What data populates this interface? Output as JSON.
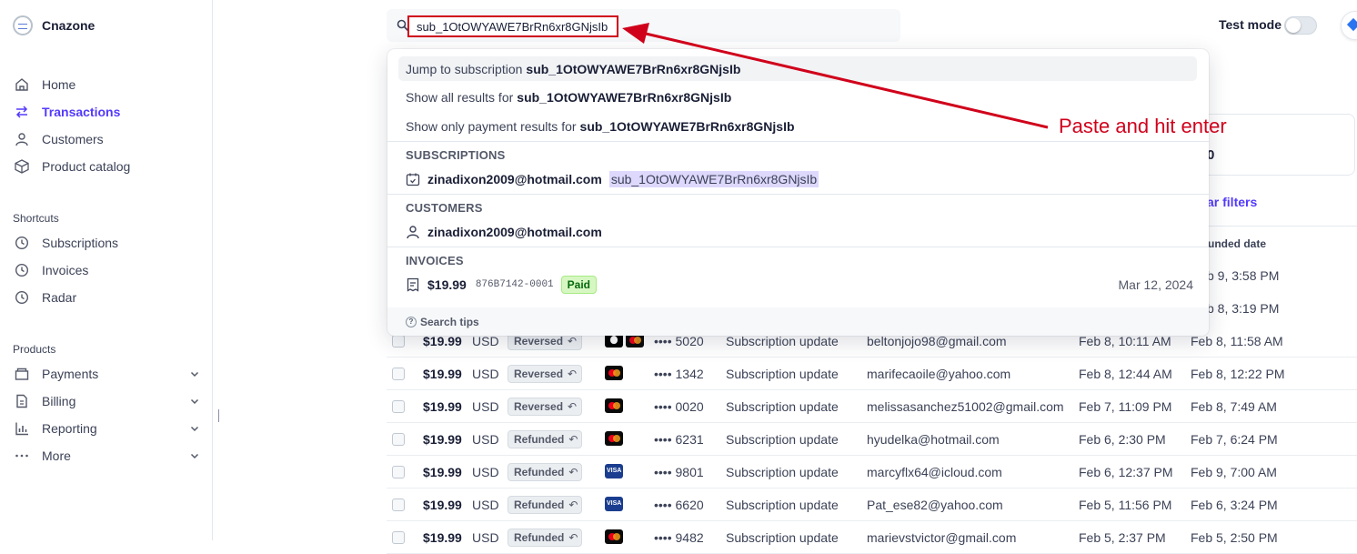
{
  "sidebar": {
    "brand": "Cnazone",
    "nav": [
      {
        "label": "Home",
        "icon": "home-icon"
      },
      {
        "label": "Transactions",
        "icon": "transactions-icon",
        "active": true
      },
      {
        "label": "Customers",
        "icon": "customers-icon"
      },
      {
        "label": "Product catalog",
        "icon": "product-catalog-icon"
      }
    ],
    "shortcuts_label": "Shortcuts",
    "shortcuts": [
      {
        "label": "Subscriptions",
        "icon": "clock-icon"
      },
      {
        "label": "Invoices",
        "icon": "clock-icon"
      },
      {
        "label": "Radar",
        "icon": "clock-icon"
      }
    ],
    "products_label": "Products",
    "products": [
      {
        "label": "Payments",
        "icon": "payments-icon"
      },
      {
        "label": "Billing",
        "icon": "billing-icon"
      },
      {
        "label": "Reporting",
        "icon": "reporting-icon"
      },
      {
        "label": "More",
        "icon": "more-icon"
      }
    ]
  },
  "topbar": {
    "search_value": "sub_1OtOWYAWE7BrRn6xr8GNjsIb",
    "test_mode_label": "Test mode"
  },
  "dropdown": {
    "jump_prefix": "Jump to subscription",
    "show_all_prefix": "Show all results for",
    "show_payments_prefix": "Show only payment results for",
    "query": "sub_1OtOWYAWE7BrRn6xr8GNjsIb",
    "subscriptions_heading": "SUBSCRIPTIONS",
    "subscription_email": "zinadixon2009@hotmail.com",
    "subscription_id": "sub_1OtOWYAWE7BrRn6xr8GNjsIb",
    "customers_heading": "CUSTOMERS",
    "customer_email": "zinadixon2009@hotmail.com",
    "invoices_heading": "INVOICES",
    "invoice_amount": "$19.99",
    "invoice_number": "876B7142-0001",
    "invoice_status": "Paid",
    "invoice_date": "Mar 12, 2024",
    "search_tips": "Search tips"
  },
  "annotation": "Paste and hit enter",
  "background": {
    "card_value": "0",
    "clear_filters": "ar filters",
    "refunded_header": "unded date",
    "partial_dates": [
      "b 9, 3:58 PM",
      "b 8, 3:19 PM"
    ]
  },
  "rows": [
    {
      "amount": "$19.99",
      "currency": "USD",
      "status": "Reversed",
      "cards": [
        "apple",
        "mc"
      ],
      "last4": "•••• 5020",
      "description": "Subscription update",
      "email": "beltonjojo98@gmail.com",
      "date": "Feb 8, 10:11 AM",
      "refunded": "Feb 8, 11:58 AM"
    },
    {
      "amount": "$19.99",
      "currency": "USD",
      "status": "Reversed",
      "cards": [
        "mc"
      ],
      "last4": "•••• 1342",
      "description": "Subscription update",
      "email": "marifecaoile@yahoo.com",
      "date": "Feb 8, 12:44 AM",
      "refunded": "Feb 8, 12:22 PM"
    },
    {
      "amount": "$19.99",
      "currency": "USD",
      "status": "Reversed",
      "cards": [
        "mc"
      ],
      "last4": "•••• 0020",
      "description": "Subscription update",
      "email": "melissasanchez51002@gmail.com",
      "date": "Feb 7, 11:09 PM",
      "refunded": "Feb 8, 7:49 AM"
    },
    {
      "amount": "$19.99",
      "currency": "USD",
      "status": "Refunded",
      "cards": [
        "mc"
      ],
      "last4": "•••• 6231",
      "description": "Subscription update",
      "email": "hyudelka@hotmail.com",
      "date": "Feb 6, 2:30 PM",
      "refunded": "Feb 7, 6:24 PM"
    },
    {
      "amount": "$19.99",
      "currency": "USD",
      "status": "Refunded",
      "cards": [
        "visa"
      ],
      "last4": "•••• 9801",
      "description": "Subscription update",
      "email": "marcyflx64@icloud.com",
      "date": "Feb 6, 12:37 PM",
      "refunded": "Feb 9, 7:00 AM"
    },
    {
      "amount": "$19.99",
      "currency": "USD",
      "status": "Refunded",
      "cards": [
        "visa"
      ],
      "last4": "•••• 6620",
      "description": "Subscription update",
      "email": "Pat_ese82@yahoo.com",
      "date": "Feb 5, 11:56 PM",
      "refunded": "Feb 6, 3:24 PM"
    },
    {
      "amount": "$19.99",
      "currency": "USD",
      "status": "Refunded",
      "cards": [
        "mc"
      ],
      "last4": "•••• 9482",
      "description": "Subscription update",
      "email": "marievstvictor@gmail.com",
      "date": "Feb 5, 2:37 PM",
      "refunded": "Feb 5, 2:50 PM"
    }
  ],
  "colors": {
    "accent": "#533afd",
    "annotation": "#d0021b",
    "paid_bg": "#d7f7c2"
  }
}
